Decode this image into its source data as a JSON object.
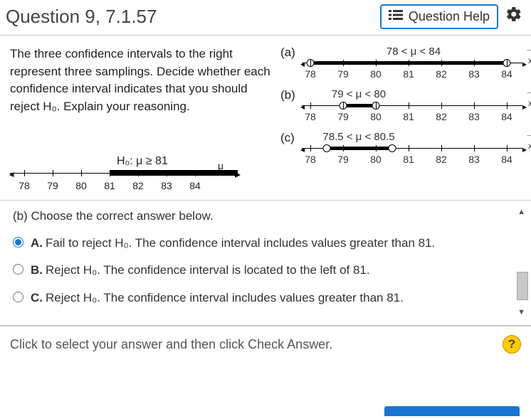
{
  "header": {
    "title": "Question 9, 7.1.57",
    "help_label": "Question Help"
  },
  "prompt": "The three confidence intervals to the right represent three samplings. Decide whether each confidence interval indicates that you should reject H₀. Explain your reasoning.",
  "h0": {
    "text": "H₀: μ ≥ 81",
    "mu": "μ"
  },
  "axis": {
    "ticks": [
      "78",
      "79",
      "80",
      "81",
      "82",
      "83",
      "84"
    ]
  },
  "intervals": {
    "a": {
      "label": "(a)",
      "text": "78 < μ < 84",
      "lo": 78,
      "hi": 84
    },
    "b": {
      "label": "(b)",
      "text": "79 < μ < 80",
      "lo": 79,
      "hi": 80
    },
    "c": {
      "label": "(c)",
      "text": "78.5 < μ < 80.5",
      "lo": 78.5,
      "hi": 80.5
    }
  },
  "question": {
    "stem": "(b) Choose the correct answer below.",
    "choices": [
      {
        "letter": "A.",
        "text": "Fail to reject H₀. The confidence interval includes values greater than 81."
      },
      {
        "letter": "B.",
        "text": "Reject H₀. The confidence interval is located to the left of 81."
      },
      {
        "letter": "C.",
        "text": "Reject H₀. The confidence interval includes values greater than 81."
      }
    ],
    "selected": 0
  },
  "footer": {
    "hint": "Click to select your answer and then click Check Answer."
  },
  "x_symbol": "x",
  "chart_data": {
    "type": "numberline-intervals",
    "axis_range": [
      78,
      84
    ],
    "ticks": [
      78,
      79,
      80,
      81,
      82,
      83,
      84
    ],
    "hypothesis": {
      "text": "μ ≥ 81",
      "boundary": 81,
      "claim_region": [
        81,
        84
      ]
    },
    "intervals": [
      {
        "id": "a",
        "low": 78,
        "high": 84,
        "open": true
      },
      {
        "id": "b",
        "low": 79,
        "high": 80,
        "open": true
      },
      {
        "id": "c",
        "low": 78.5,
        "high": 80.5,
        "open": true
      }
    ]
  }
}
